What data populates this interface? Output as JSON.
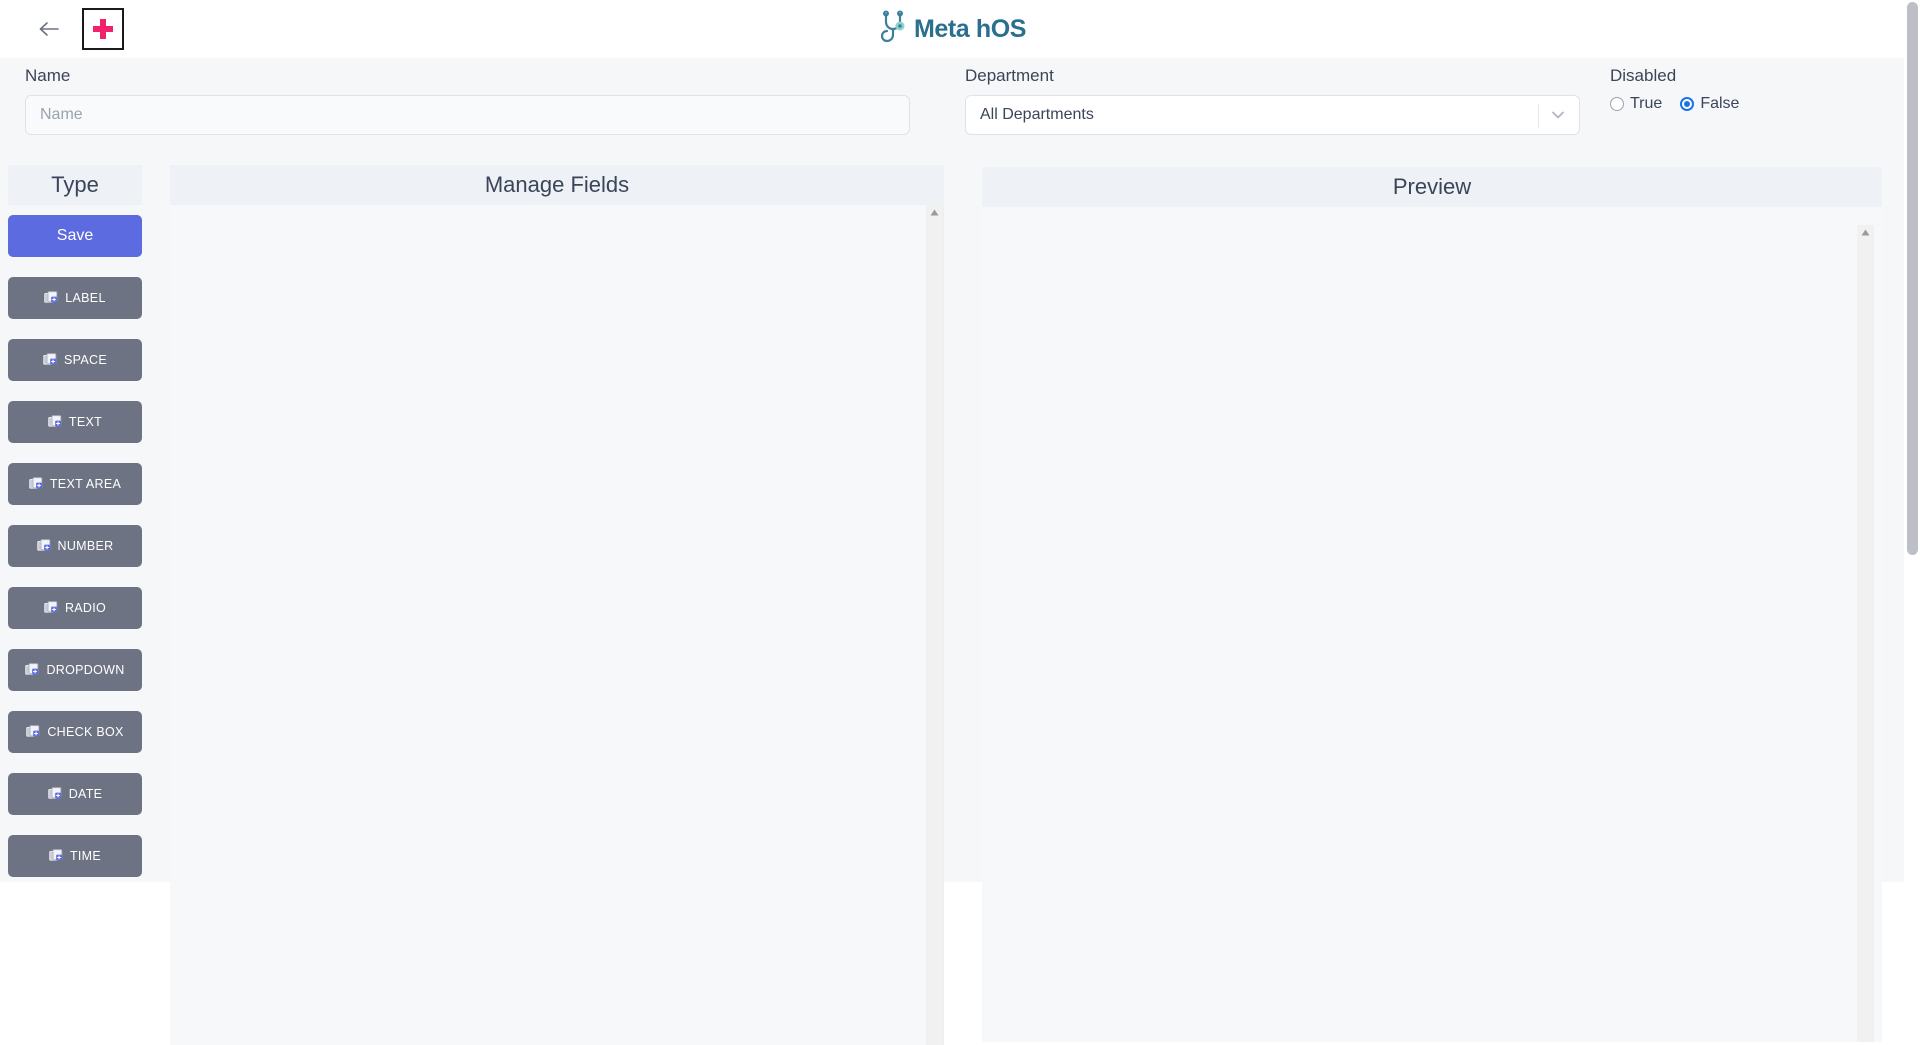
{
  "header": {
    "back_icon": "arrow-left-icon",
    "logo_icon": "red-cross-logo",
    "brand_icon": "stethoscope-icon",
    "brand_text": "Meta hOS"
  },
  "form": {
    "name": {
      "label": "Name",
      "value": "",
      "placeholder": "Name"
    },
    "department": {
      "label": "Department",
      "selected": "All Departments",
      "caret_icon": "chevron-down-icon"
    },
    "disabled": {
      "label": "Disabled",
      "options": [
        {
          "label": "True",
          "checked": false
        },
        {
          "label": "False",
          "checked": true
        }
      ]
    }
  },
  "panels": {
    "type_header": "Type",
    "manage_header": "Manage Fields",
    "preview_header": "Preview"
  },
  "type_buttons": [
    {
      "label": "Save",
      "style": "save",
      "icon": ""
    },
    {
      "label": "LABEL",
      "style": "item",
      "icon": "copy-plus-icon"
    },
    {
      "label": "SPACE",
      "style": "item",
      "icon": "copy-plus-icon"
    },
    {
      "label": "TEXT",
      "style": "item",
      "icon": "copy-plus-icon"
    },
    {
      "label": "TEXT AREA",
      "style": "item",
      "icon": "copy-plus-icon"
    },
    {
      "label": "NUMBER",
      "style": "item",
      "icon": "copy-plus-icon"
    },
    {
      "label": "RADIO",
      "style": "item",
      "icon": "copy-plus-icon"
    },
    {
      "label": "DROPDOWN",
      "style": "item",
      "icon": "copy-plus-icon"
    },
    {
      "label": "CHECK BOX",
      "style": "item",
      "icon": "copy-plus-icon"
    },
    {
      "label": "DATE",
      "style": "item",
      "icon": "copy-plus-icon"
    },
    {
      "label": "TIME",
      "style": "item",
      "icon": "copy-plus-icon"
    }
  ],
  "scrollbars": {
    "up_arrow_icon": "scroll-up-arrow"
  },
  "colors": {
    "accent_save": "#5c6be0",
    "type_button": "#6e7383",
    "radio_checked": "#1a73e8",
    "brand": "#2b6f8e",
    "logo_cross": "#f3206b",
    "panel_header_bg": "#eef1f6",
    "page_bg": "#f6f7f9"
  }
}
